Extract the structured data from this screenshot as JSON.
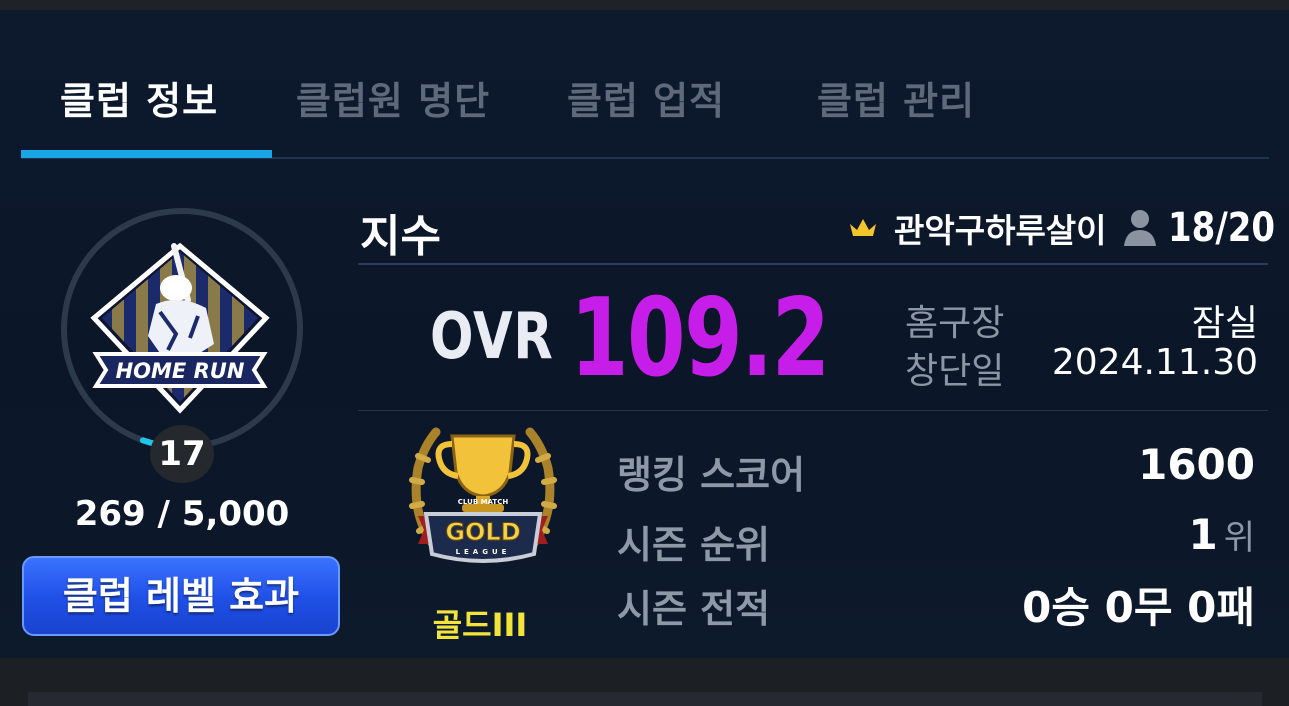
{
  "tabs": [
    {
      "label": "클럽 정보",
      "active": true
    },
    {
      "label": "클럽원 명단",
      "active": false
    },
    {
      "label": "클럽 업적",
      "active": false
    },
    {
      "label": "클럽 관리",
      "active": false
    }
  ],
  "club": {
    "emblem_text": "HOME RUN",
    "level": "17",
    "exp": "269 / 5,000",
    "exp_progress": 0.0538,
    "level_button": "클럽 레벨 효과"
  },
  "stats": {
    "title": "지수",
    "leader": "관악구하루살이",
    "members": "18/20",
    "ovr_label": "OVR",
    "ovr_value": "109.2",
    "home_label": "홈구장",
    "home_value": "잠실",
    "founded_label": "창단일",
    "founded_value": "2024.11.30"
  },
  "ranking": {
    "badge_top": "CLUB MATCH",
    "badge_main": "GOLD",
    "badge_bottom": "LEAGUE",
    "tier": "골드III",
    "score_label": "랭킹 스코어",
    "score_value": "1600",
    "rank_label": "시즌 순위",
    "rank_value": "1",
    "rank_unit": "위",
    "record_label": "시즌 전적",
    "record_value": "0승 0무 0패"
  },
  "icons": {
    "crown": "crown-icon",
    "member": "person-icon",
    "trophy": "trophy-icon"
  },
  "colors": {
    "accent": "#18a6e6",
    "ovr": "#c61ee8",
    "tier": "#f2e43a",
    "button": "#2a5ff0"
  }
}
